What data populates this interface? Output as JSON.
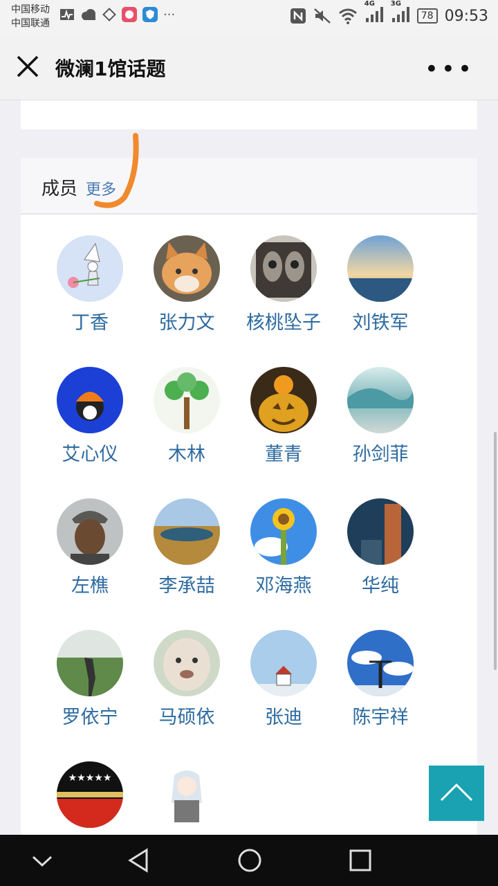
{
  "status_bar": {
    "carrier_1": "中国移动",
    "carrier_2": "中国联通",
    "net_4g": "4G",
    "net_3g": "3G",
    "battery": "78",
    "time": "09:53"
  },
  "navbar": {
    "title": "微澜1馆话题"
  },
  "members_section": {
    "label": "成员",
    "more": "更多",
    "members": [
      {
        "name": "丁香"
      },
      {
        "name": "张力文"
      },
      {
        "name": "核桃坠子"
      },
      {
        "name": "刘铁军"
      },
      {
        "name": "艾心仪"
      },
      {
        "name": "木林"
      },
      {
        "name": "董青"
      },
      {
        "name": "孙剑菲"
      },
      {
        "name": "左樵"
      },
      {
        "name": "李承喆"
      },
      {
        "name": "邓海燕"
      },
      {
        "name": "华纯"
      },
      {
        "name": "罗依宁"
      },
      {
        "name": "马硕依"
      },
      {
        "name": "张迪"
      },
      {
        "name": "陈宇祥"
      }
    ]
  },
  "colors": {
    "link": "#2d6aa0",
    "scroll_top_bg": "#1aa2b3",
    "annotation": "#f08a2e"
  }
}
